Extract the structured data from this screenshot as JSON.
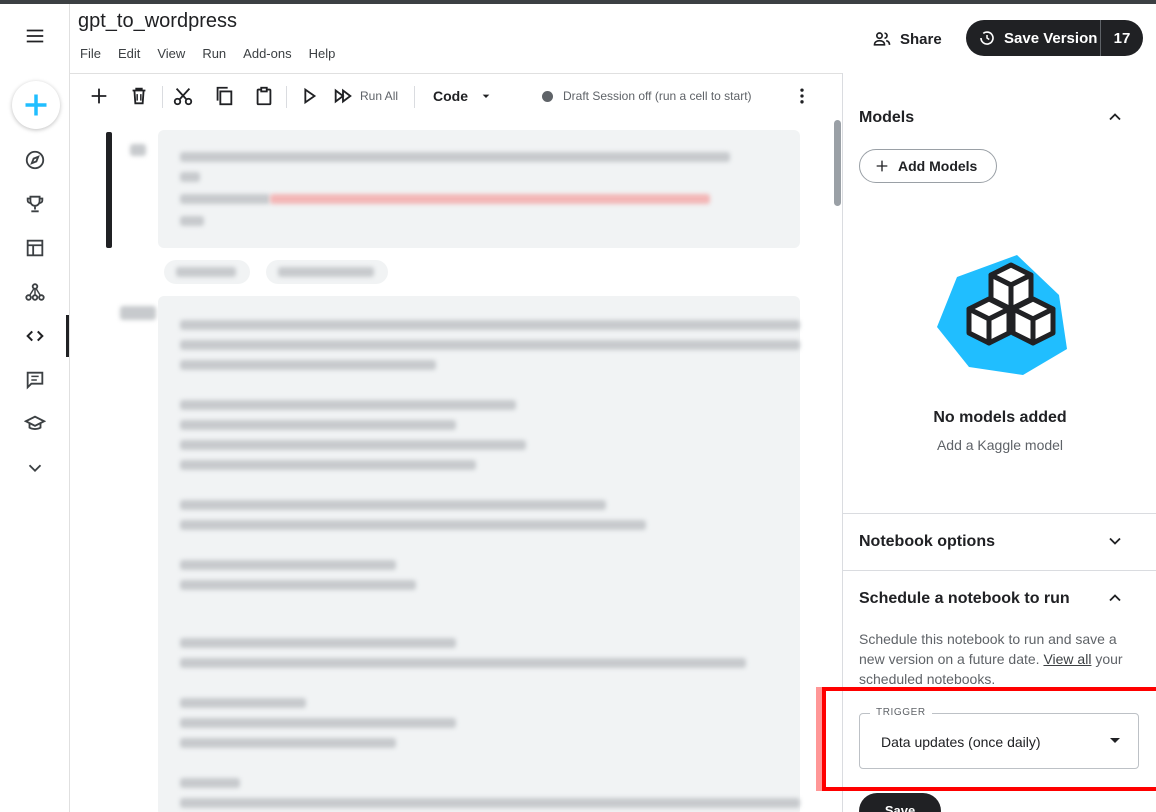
{
  "notebook": {
    "title": "gpt_to_wordpress",
    "menu": [
      "File",
      "Edit",
      "View",
      "Run",
      "Add-ons",
      "Help"
    ]
  },
  "header": {
    "share_label": "Share",
    "save_version_label": "Save Version",
    "version_count": "17"
  },
  "toolbar": {
    "run_all_label": "Run All",
    "cell_type": "Code",
    "session_status": "Draft Session off (run a cell to start)"
  },
  "panel": {
    "models": {
      "title": "Models",
      "add_button": "Add Models",
      "empty_title": "No models added",
      "empty_subtitle": "Add a Kaggle model"
    },
    "notebook_options": {
      "title": "Notebook options"
    },
    "schedule": {
      "title": "Schedule a notebook to run",
      "description": "Schedule this notebook to run and save a new version on a future date.",
      "link": "View all",
      "description_tail": "your scheduled notebooks.",
      "trigger_label": "TRIGGER",
      "trigger_value": "Data updates (once daily)",
      "save_label": "Save"
    }
  },
  "colors": {
    "accent": "#20beff",
    "dark": "#202124",
    "annotation": "#ff0000"
  },
  "icons": [
    "hamburger-icon",
    "plus-icon",
    "compass-icon",
    "trophy-icon",
    "table-icon",
    "models-icon",
    "code-icon",
    "discussion-icon",
    "learn-icon",
    "chevron-down-icon"
  ]
}
